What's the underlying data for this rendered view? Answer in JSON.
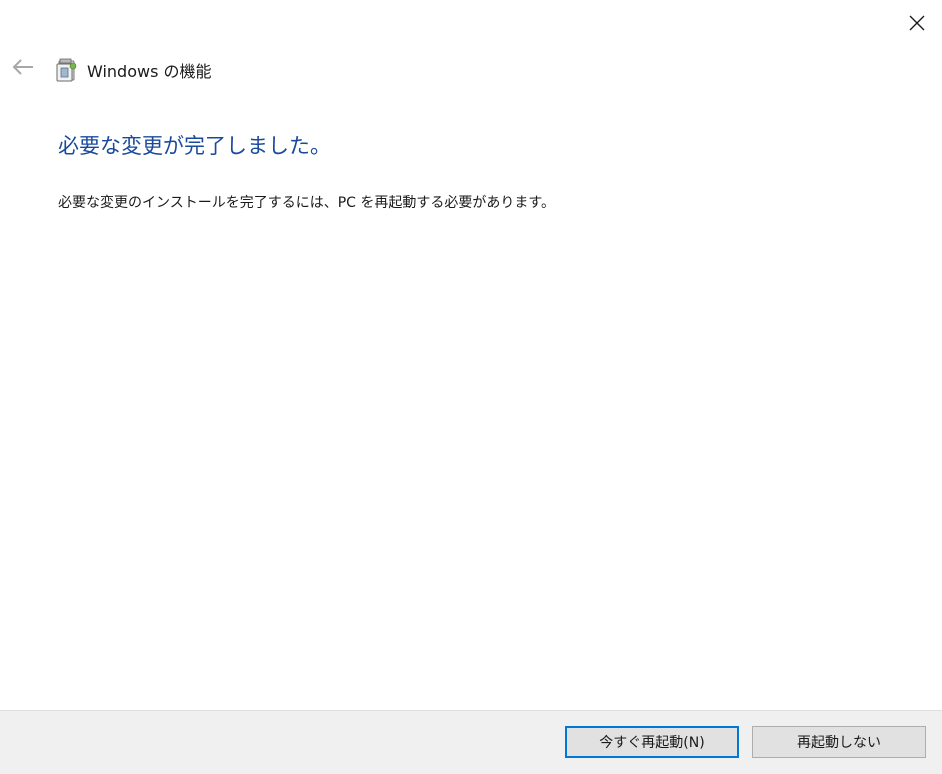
{
  "window": {
    "title": "Windows の機能",
    "close_icon": "close-icon",
    "back_icon": "back-arrow-icon",
    "app_icon": "windows-features-icon"
  },
  "main": {
    "heading": "必要な変更が完了しました。",
    "message": "必要な変更のインストールを完了するには、PC を再起動する必要があります。"
  },
  "footer": {
    "restart_now_label": "今すぐ再起動(N)",
    "dont_restart_label": "再起動しない"
  },
  "colors": {
    "heading": "#1a4a9c",
    "primary_border": "#0078d7",
    "footer_bg": "#f0f0f0"
  }
}
